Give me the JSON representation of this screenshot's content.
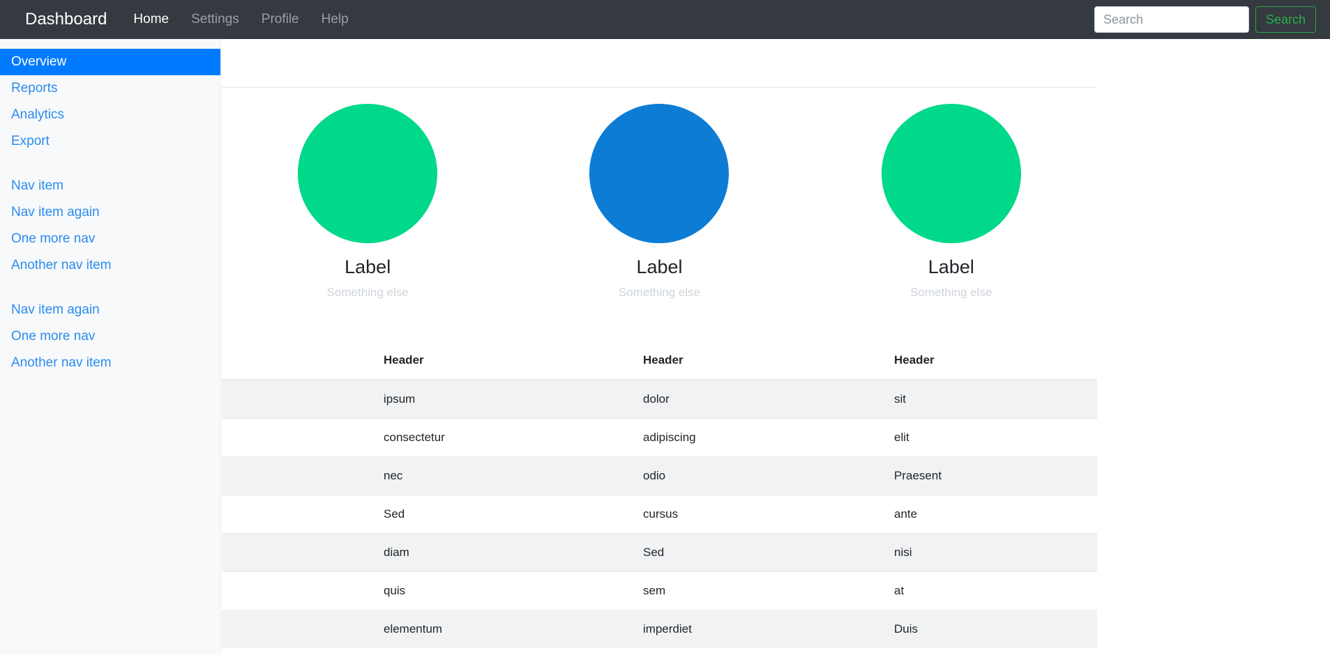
{
  "navbar": {
    "brand": "Dashboard",
    "links": [
      {
        "label": "Home",
        "active": true
      },
      {
        "label": "Settings",
        "active": false
      },
      {
        "label": "Profile",
        "active": false
      },
      {
        "label": "Help",
        "active": false
      }
    ],
    "search": {
      "placeholder": "Search",
      "value": "",
      "button_label": "Search"
    },
    "colors": {
      "background": "#343a40",
      "active_link": "#ffffff",
      "muted_link": "rgba(255,255,255,0.5)",
      "search_button": "#28a745"
    }
  },
  "sidebar": {
    "groups": [
      {
        "items": [
          {
            "label": "Overview",
            "active": true
          },
          {
            "label": "Reports",
            "active": false
          },
          {
            "label": "Analytics",
            "active": false
          },
          {
            "label": "Export",
            "active": false
          }
        ]
      },
      {
        "items": [
          {
            "label": "Nav item",
            "active": false
          },
          {
            "label": "Nav item again",
            "active": false
          },
          {
            "label": "One more nav",
            "active": false
          },
          {
            "label": "Another nav item",
            "active": false
          }
        ]
      },
      {
        "items": [
          {
            "label": "Nav item again",
            "active": false
          },
          {
            "label": "One more nav",
            "active": false
          },
          {
            "label": "Another nav item",
            "active": false
          }
        ]
      }
    ],
    "colors": {
      "background": "#f8f9fa",
      "link": "#2a8cf0",
      "active_background": "#007bff",
      "active_link": "#ffffff"
    }
  },
  "main": {
    "features": [
      {
        "label": "Label",
        "subtext": "Something else",
        "color": "#00d98a"
      },
      {
        "label": "Label",
        "subtext": "Something else",
        "color": "#0c7cd5"
      },
      {
        "label": "Label",
        "subtext": "Something else",
        "color": "#00d98a"
      }
    ],
    "table": {
      "headers": [
        "",
        "Header",
        "Header",
        "Header"
      ],
      "rows": [
        {
          "cells": [
            "",
            "ipsum",
            "dolor",
            "sit"
          ],
          "striped": true
        },
        {
          "cells": [
            "",
            "consectetur",
            "adipiscing",
            "elit"
          ],
          "striped": false
        },
        {
          "cells": [
            "",
            "nec",
            "odio",
            "Praesent"
          ],
          "striped": true
        },
        {
          "cells": [
            "",
            "Sed",
            "cursus",
            "ante"
          ],
          "striped": false
        },
        {
          "cells": [
            "",
            "diam",
            "Sed",
            "nisi"
          ],
          "striped": true
        },
        {
          "cells": [
            "",
            "quis",
            "sem",
            "at"
          ],
          "striped": false
        },
        {
          "cells": [
            "",
            "elementum",
            "imperdiet",
            "Duis"
          ],
          "striped": true
        }
      ]
    }
  }
}
